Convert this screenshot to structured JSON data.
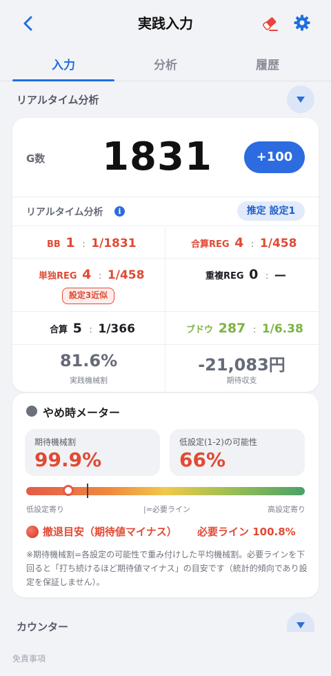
{
  "header": {
    "title": "実践入力",
    "back_icon": "chevron-left-icon",
    "eraser_icon": "eraser-icon",
    "settings_icon": "gear-icon",
    "accent": "#1f6fde"
  },
  "tabs": [
    {
      "label": "入力",
      "active": true
    },
    {
      "label": "分析",
      "active": false
    },
    {
      "label": "履歴",
      "active": false
    }
  ],
  "realtime_section": {
    "title": "リアルタイム分析",
    "gcount_label": "G数",
    "gcount_value": "1831",
    "plus_button": "+100",
    "analysis_label": "リアルタイム分析",
    "info_icon": "i",
    "estimate_badge": "推定 設定1",
    "stats": {
      "bb": {
        "label": "BB",
        "count": "1",
        "sep": ":",
        "prob": "1/1831"
      },
      "combined_reg": {
        "label": "合算REG",
        "count": "4",
        "sep": ":",
        "prob": "1/458"
      },
      "single_reg": {
        "label": "単独REG",
        "count": "4",
        "sep": ":",
        "prob": "1/458",
        "chip": "設定3近似"
      },
      "overlap_reg": {
        "label": "重複REG",
        "count": "0",
        "sep": ":",
        "prob": "—"
      },
      "total": {
        "label": "合算",
        "count": "5",
        "sep": ":",
        "prob": "1/366"
      },
      "grape": {
        "label": "ブドウ",
        "count": "287",
        "sep": ":",
        "prob": "1/6.38"
      }
    },
    "payout_rate": {
      "value": "81.6%",
      "label": "実践機械割"
    },
    "expected_balance": {
      "value": "-21,083円",
      "label": "期待収支"
    }
  },
  "meter": {
    "icon": "gauge-icon",
    "title": "やめ時メーター",
    "expected_payout": {
      "caption": "期待機械割",
      "value": "99.9%"
    },
    "low_setting_prob": {
      "caption": "低設定(1-2)の可能性",
      "value": "66%"
    },
    "bar_position": 0.15,
    "required_mark_position": 0.22,
    "scale": {
      "left": "低設定寄り",
      "middle": "|=必要ライン",
      "right": "高設定寄り"
    },
    "verdict": "撤退目安（期待値マイナス）",
    "required_line": "必要ライン 100.8%",
    "note": "※期待機械割=各設定の可能性で重み付けした平均機械割。必要ラインを下回ると「打ち続けるほど期待値マイナス」の目安です（統計的傾向であり設定を保証しません）。"
  },
  "counter_section": {
    "title": "カウンター"
  },
  "footer": {
    "disclaimer": "免責事項"
  }
}
